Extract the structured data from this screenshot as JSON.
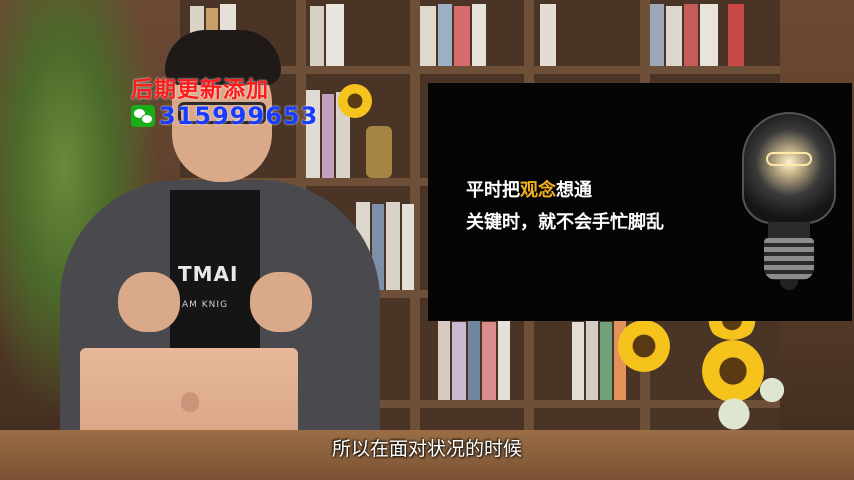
{
  "overlay": {
    "title": "后期更新添加",
    "wechat_icon": "wechat-icon",
    "wechat_number": "315999653"
  },
  "slide": {
    "line1_before": "平时把",
    "line1_highlight": "观念",
    "line1_after": "想通",
    "line2": "关键时，就不会手忙脚乱",
    "highlight_color": "#f2b01e",
    "icon": "lightbulb-icon"
  },
  "shirt": {
    "text_main": "TMAI",
    "text_sub": "AM KNIG"
  },
  "subtitle": "所以在面对状况的时候",
  "colors": {
    "overlay_title": "#ff1a1a",
    "wechat_number": "#1a3cff",
    "slide_bg": "#050505"
  }
}
